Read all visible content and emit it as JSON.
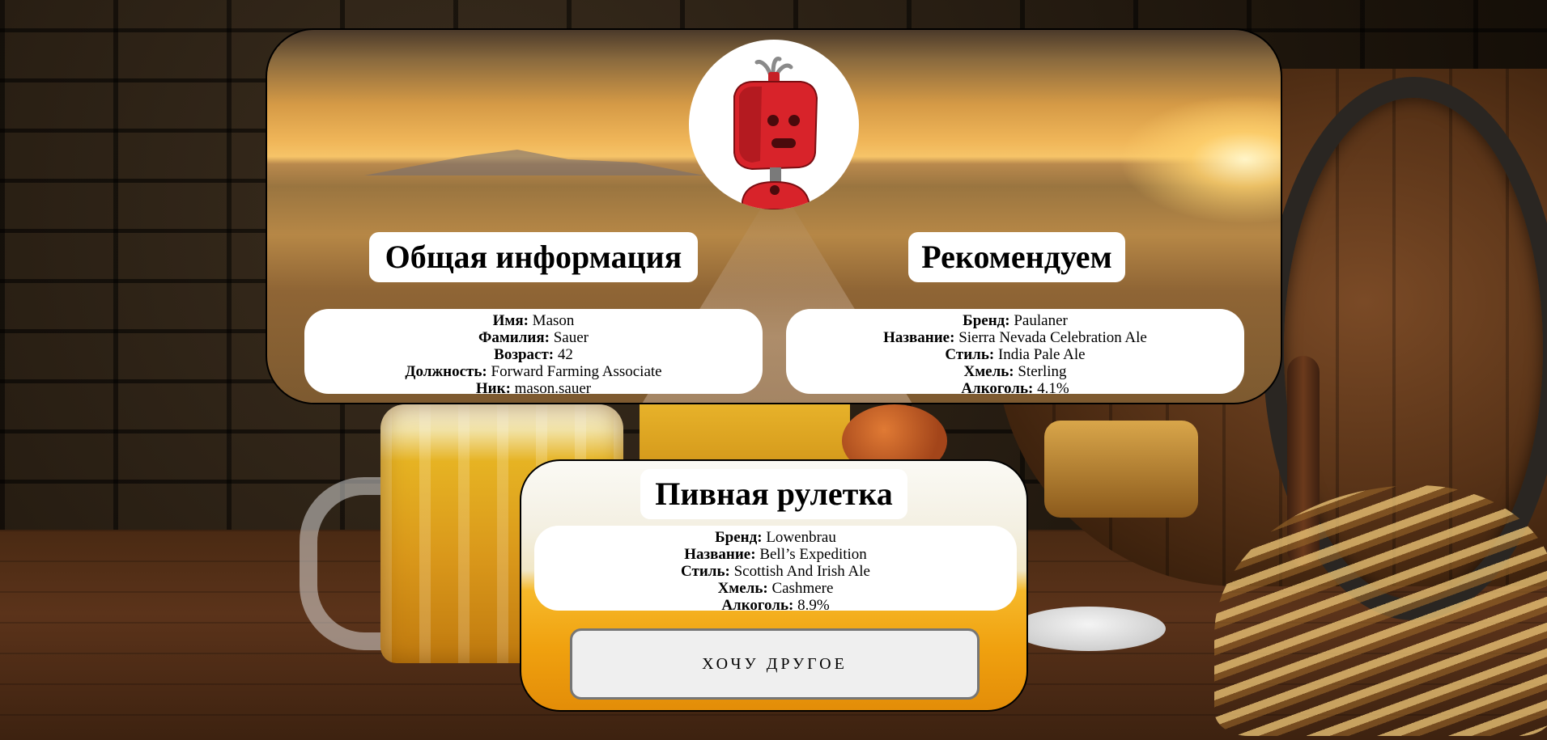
{
  "profile": {
    "avatar_icon": "red-robot-avatar-icon",
    "general_title": "Общая информация",
    "fields": [
      {
        "label": "Имя:",
        "value": "Mason"
      },
      {
        "label": "Фамилия:",
        "value": "Sauer"
      },
      {
        "label": "Возраст:",
        "value": "42"
      },
      {
        "label": "Должность:",
        "value": "Forward Farming Associate"
      },
      {
        "label": "Ник:",
        "value": "mason.sauer"
      }
    ]
  },
  "recommended": {
    "title": "Рекомендуем",
    "fields": [
      {
        "label": "Бренд:",
        "value": "Paulaner"
      },
      {
        "label": "Название:",
        "value": "Sierra Nevada Celebration Ale"
      },
      {
        "label": "Стиль:",
        "value": "India Pale Ale"
      },
      {
        "label": "Хмель:",
        "value": "Sterling"
      },
      {
        "label": "Алкоголь:",
        "value": "4.1%"
      }
    ]
  },
  "roulette": {
    "title": "Пивная рулетка",
    "fields": [
      {
        "label": "Бренд:",
        "value": "Lowenbrau"
      },
      {
        "label": "Название:",
        "value": "Bell’s Expedition"
      },
      {
        "label": "Стиль:",
        "value": "Scottish And Irish Ale"
      },
      {
        "label": "Хмель:",
        "value": "Cashmere"
      },
      {
        "label": "Алкоголь:",
        "value": "8.9%"
      }
    ],
    "button_label": "ХОЧУ ДРУГОЕ"
  },
  "colors": {
    "card_border": "#000000",
    "panel_background": "#ffffff",
    "button_background": "#efefef",
    "button_border": "#767676",
    "robot_red": "#d8232a"
  }
}
